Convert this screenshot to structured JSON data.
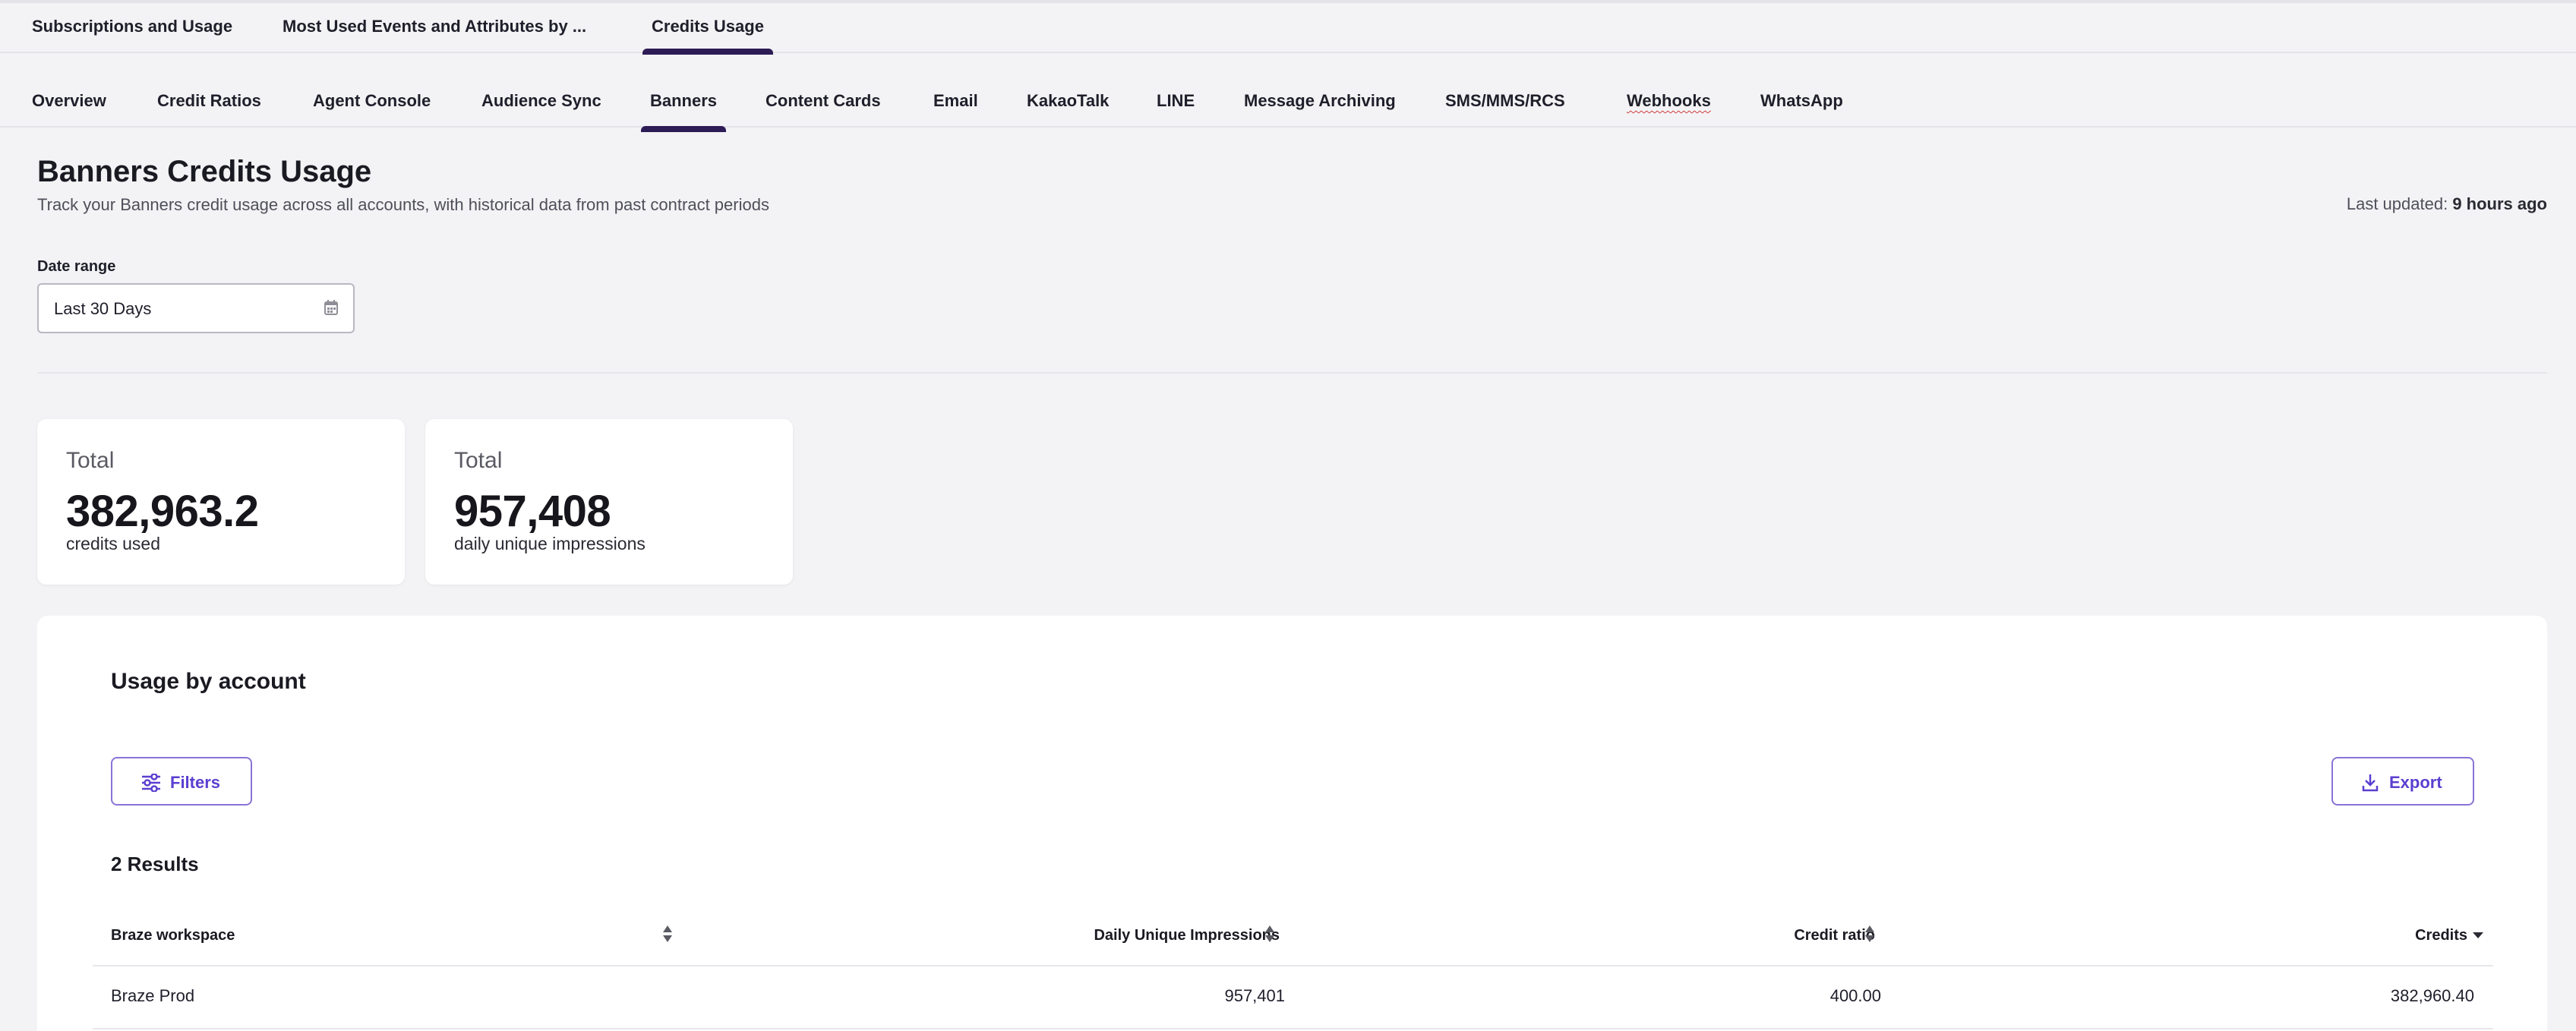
{
  "top_tabs": [
    "Subscriptions and Usage",
    "Most Used Events and Attributes by ...",
    "Credits Usage"
  ],
  "sub_tabs": [
    "Overview",
    "Credit Ratios",
    "Agent Console",
    "Audience Sync",
    "Banners",
    "Content Cards",
    "Email",
    "KakaoTalk",
    "LINE",
    "Message Archiving",
    "SMS/MMS/RCS",
    "Webhooks",
    "WhatsApp"
  ],
  "active_top_tab": "Credits Usage",
  "active_sub_tab": "Banners",
  "page": {
    "title": "Banners Credits Usage",
    "subtitle": "Track your Banners credit usage across all accounts, with historical data from past contract periods",
    "last_updated_label": "Last updated:",
    "last_updated_value": "9 hours ago"
  },
  "date_range": {
    "label": "Date range",
    "value": "Last 30 Days",
    "icon": "calendar-icon"
  },
  "cards": [
    {
      "label": "Total",
      "value": "382,963.2",
      "unit": "credits used"
    },
    {
      "label": "Total",
      "value": "957,408",
      "unit": "daily unique impressions"
    }
  ],
  "usage": {
    "title": "Usage by account",
    "filters_label": "Filters",
    "export_label": "Export",
    "results_label": "2 Results",
    "columns": [
      "Braze workspace",
      "Daily Unique Impressions",
      "Credit ratio",
      "Credits"
    ],
    "rows": [
      [
        "Braze Prod",
        "957,401",
        "400.00",
        "382,960.40"
      ]
    ]
  },
  "colors": {
    "accent": "#5b3fd0",
    "tab_indicator": "#2d1b55",
    "background": "#f3f3f5"
  }
}
